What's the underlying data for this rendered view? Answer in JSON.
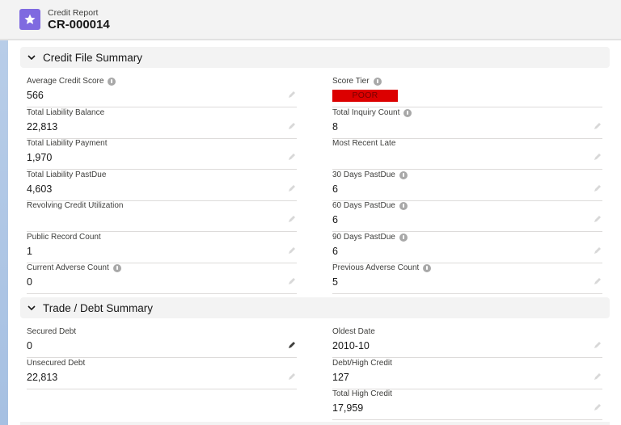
{
  "header": {
    "object_label": "Credit Report",
    "record_name": "CR-000014",
    "icon": "star-icon",
    "icon_color": "#7f6ae0"
  },
  "sections": [
    {
      "title": "Credit File Summary",
      "left": [
        {
          "label": "Average Credit Score",
          "value": "566",
          "info": true
        },
        {
          "label": "Total Liability Balance",
          "value": "22,813",
          "info": false
        },
        {
          "label": "Total Liability Payment",
          "value": "1,970",
          "info": false
        },
        {
          "label": "Total Liability PastDue",
          "value": "4,603",
          "info": false
        },
        {
          "label": "Revolving Credit Utilization",
          "value": "",
          "info": false
        },
        {
          "label": "Public Record Count",
          "value": "1",
          "info": false
        },
        {
          "label": "Current Adverse Count",
          "value": "0",
          "info": true
        }
      ],
      "right": [
        {
          "label": "Score Tier",
          "value": "POOR",
          "info": true,
          "badge_color": "#dc0000",
          "badge_text_color": "#7a0000"
        },
        {
          "label": "Total Inquiry Count",
          "value": "8",
          "info": true
        },
        {
          "label": "Most Recent Late",
          "value": "",
          "info": false
        },
        {
          "label": "30 Days PastDue",
          "value": "6",
          "info": true
        },
        {
          "label": "60 Days PastDue",
          "value": "6",
          "info": true
        },
        {
          "label": "90 Days PastDue",
          "value": "6",
          "info": true
        },
        {
          "label": "Previous Adverse Count",
          "value": "5",
          "info": true
        }
      ]
    },
    {
      "title": "Trade / Debt Summary",
      "left": [
        {
          "label": "Secured Debt",
          "value": "0",
          "info": false
        },
        {
          "label": "Unsecured Debt",
          "value": "22,813",
          "info": false
        }
      ],
      "right": [
        {
          "label": "Oldest Date",
          "value": "2010-10",
          "info": false
        },
        {
          "label": "Debt/High Credit",
          "value": "127",
          "info": false
        },
        {
          "label": "Total High Credit",
          "value": "17,959",
          "info": false
        }
      ]
    }
  ]
}
